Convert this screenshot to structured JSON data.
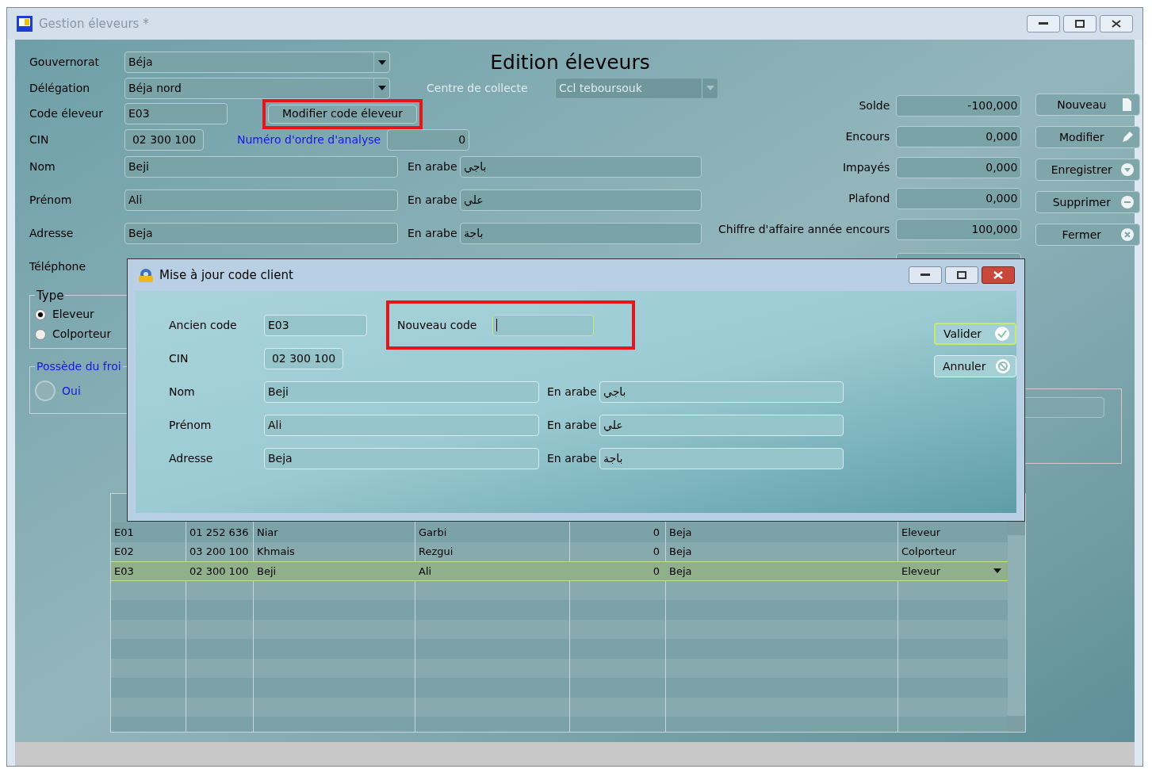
{
  "window": {
    "title": "Gestion éleveurs *",
    "heading": "Edition éleveurs"
  },
  "form": {
    "gouvernorat": {
      "label": "Gouvernorat",
      "value": "Béja"
    },
    "delegation": {
      "label": "Délégation",
      "value": "Béja nord"
    },
    "centre": {
      "label": "Centre de collecte",
      "value": "Ccl teboursouk",
      "disabled": true
    },
    "code": {
      "label": "Code éleveur",
      "value": "E03"
    },
    "modify_code_button": {
      "label": "Modifier code éleveur",
      "highlighted": true
    },
    "cin": {
      "label": "CIN",
      "value": "02 300 100"
    },
    "ordre": {
      "label": "Numéro d'ordre d'analyse",
      "value": "0"
    },
    "names": [
      {
        "label": "Nom",
        "value": "Beji",
        "arabic_label": "En arabe",
        "arabic_value": "باجي"
      },
      {
        "label": "Prénom",
        "value": "Ali",
        "arabic_label": "En arabe",
        "arabic_value": "علي"
      },
      {
        "label": "Adresse",
        "value": "Beja",
        "arabic_label": "En arabe",
        "arabic_value": "باجة"
      }
    ],
    "telephone": {
      "label": "Téléphone"
    },
    "type": {
      "legend": "Type",
      "options": [
        {
          "label": "Eleveur",
          "selected": true
        },
        {
          "label": "Colporteur",
          "selected": false
        }
      ]
    },
    "froid": {
      "legend": "Possède du froi",
      "options": [
        {
          "label": "Oui",
          "selected": false
        }
      ]
    }
  },
  "finance": [
    {
      "label": "Solde",
      "value": "-100,000"
    },
    {
      "label": "Encours",
      "value": "0,000"
    },
    {
      "label": "Impayés",
      "value": "0,000"
    },
    {
      "label": "Plafond",
      "value": "0,000"
    },
    {
      "label": "Chiffre d'affaire année encours",
      "value": "100,000"
    }
  ],
  "actions": [
    {
      "label": "Nouveau",
      "kind": "new"
    },
    {
      "label": "Modifier",
      "kind": "edit"
    },
    {
      "label": "Enregistrer",
      "kind": "save"
    },
    {
      "label": "Supprimer",
      "kind": "delete"
    },
    {
      "label": "Fermer",
      "kind": "close"
    }
  ],
  "table": {
    "rows": [
      {
        "cells": [
          "E01",
          "01 252 636",
          "Niar",
          "Garbi",
          "0",
          "Beja",
          "Eleveur"
        ],
        "selected": false
      },
      {
        "cells": [
          "E02",
          "03 200 100",
          "Khmais",
          "Rezgui",
          "0",
          "Beja",
          "Colporteur"
        ],
        "selected": false
      },
      {
        "cells": [
          "E03",
          "02 300 100",
          "Beji",
          "Ali",
          "0",
          "Beja",
          "Eleveur"
        ],
        "selected": true
      }
    ]
  },
  "dialog": {
    "title": "Mise à jour code client",
    "old_code": {
      "label": "Ancien code",
      "value": "E03"
    },
    "new_code": {
      "label": "Nouveau code",
      "highlighted": true
    },
    "cin": {
      "label": "CIN",
      "value": "02 300 100"
    },
    "names": [
      {
        "label": "Nom",
        "value": "Beji",
        "arabic_label": "En arabe",
        "arabic_value": "باجي"
      },
      {
        "label": "Prénom",
        "value": "Ali",
        "arabic_label": "En arabe",
        "arabic_value": "علي"
      },
      {
        "label": "Adresse",
        "value": "Beja",
        "arabic_label": "En arabe",
        "arabic_value": "باجة"
      }
    ],
    "buttons": [
      {
        "label": "Valider",
        "kind": "ok",
        "default": true
      },
      {
        "label": "Annuler",
        "kind": "cancel",
        "default": false
      }
    ]
  }
}
